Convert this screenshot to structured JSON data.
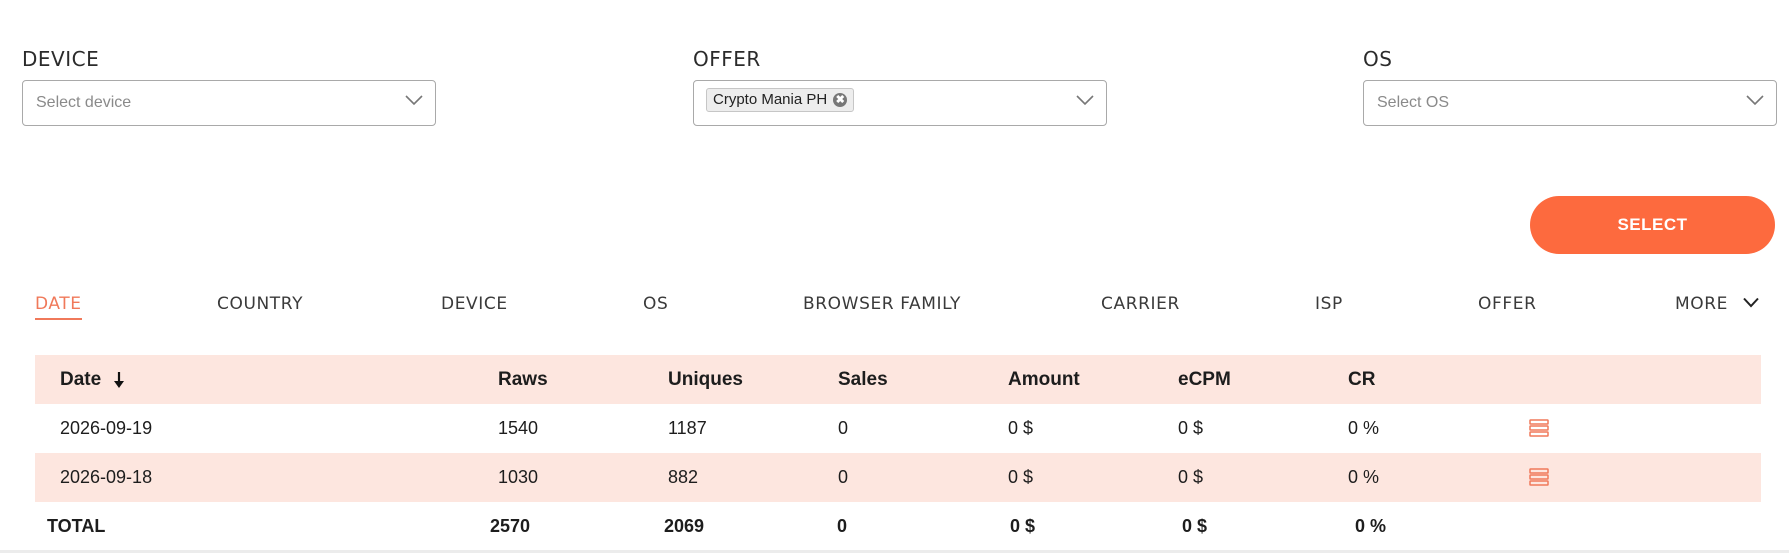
{
  "filters": {
    "device": {
      "label": "DEVICE",
      "placeholder": "Select device"
    },
    "offer": {
      "label": "OFFER",
      "selected_chip": "Crypto Mania PH",
      "remove_symbol": "✖"
    },
    "os": {
      "label": "OS",
      "placeholder": "Select OS"
    }
  },
  "select_button": {
    "label": "SELECT"
  },
  "tabs": [
    {
      "label": "DATE",
      "active": true
    },
    {
      "label": "COUNTRY"
    },
    {
      "label": "DEVICE"
    },
    {
      "label": "OS"
    },
    {
      "label": "BROWSER FAMILY"
    },
    {
      "label": "CARRIER"
    },
    {
      "label": "ISP"
    },
    {
      "label": "OFFER"
    },
    {
      "label": "MORE"
    }
  ],
  "table": {
    "headers": [
      "Date",
      "Raws",
      "Uniques",
      "Sales",
      "Amount",
      "eCPM",
      "CR"
    ],
    "sort": "descending",
    "rows": [
      [
        "2026-09-19",
        "1540",
        "1187",
        "0",
        "0 $",
        "0 $",
        "0 %"
      ],
      [
        "2026-09-18",
        "1030",
        "882",
        "0",
        "0 $",
        "0 $",
        "0 %"
      ]
    ],
    "total": [
      "TOTAL",
      "2570",
      "2069",
      "0",
      "0 $",
      "0 $",
      "0 %"
    ]
  },
  "colors": {
    "accent": "#fd6a3e",
    "active_tab": "#f0795a",
    "row_highlight": "#fde6df"
  },
  "icons": {
    "dropdown": "chevron-down-icon",
    "sort": "sort-down-arrow-icon",
    "row_action": "details-list-icon",
    "chip_remove": "close-icon"
  }
}
